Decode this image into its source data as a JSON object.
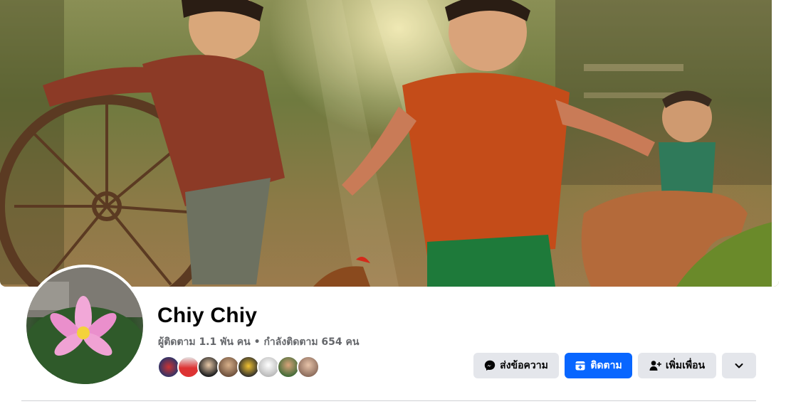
{
  "profile": {
    "name": "Chiy Chiy",
    "followers_text": "ผู้ติดตาม 1.1 พัน คน",
    "separator": "•",
    "following_text": "กำลังติดตาม 654 คน"
  },
  "actions": {
    "message_label": "ส่งข้อความ",
    "follow_label": "ติดตาม",
    "add_friend_label": "เพิ่มเพื่อน"
  },
  "icons": {
    "message": "messenger-icon",
    "follow": "follow-icon",
    "add_friend": "add-friend-icon",
    "more": "chevron-down-icon"
  },
  "colors": {
    "primary": "#0866ff",
    "secondary_button": "#e4e6eb",
    "text_primary": "#050505",
    "text_secondary": "#65676b"
  },
  "friend_avatars_count": 8
}
